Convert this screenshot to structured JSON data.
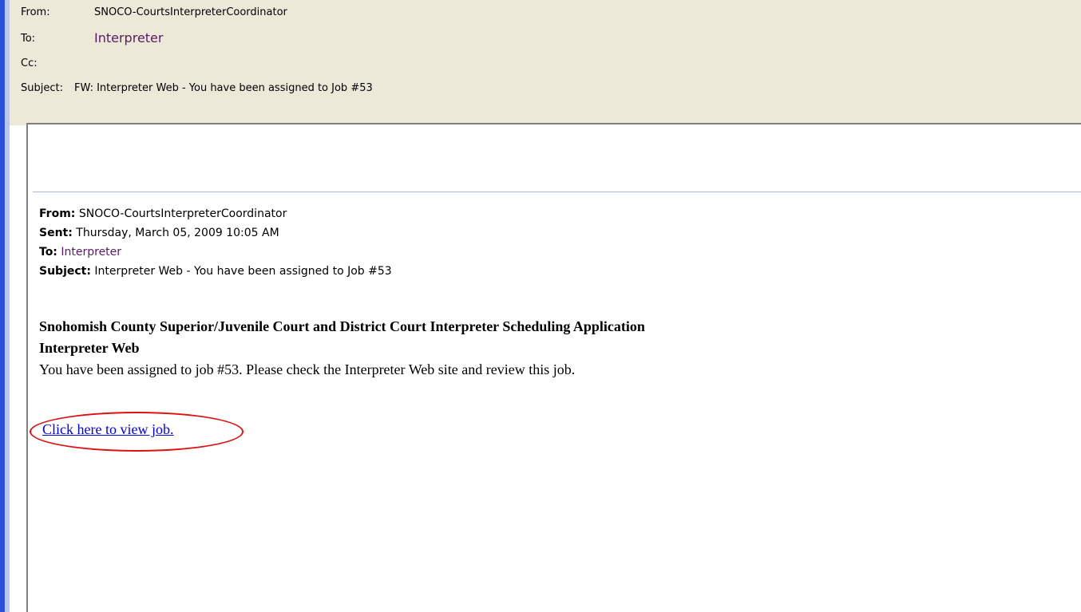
{
  "header": {
    "from_label": "From:",
    "from_value": "SNOCO-CourtsInterpreterCoordinator",
    "to_label": "To:",
    "to_value": "Interpreter",
    "cc_label": "Cc:",
    "cc_value": "",
    "subject_label": "Subject:",
    "subject_value": "FW: Interpreter Web - You have been assigned to Job #53"
  },
  "forwarded": {
    "from_label": "From:",
    "from_value": "SNOCO-CourtsInterpreterCoordinator",
    "sent_label": "Sent:",
    "sent_value": "Thursday, March 05, 2009 10:05 AM",
    "to_label": "To:",
    "to_value": "Interpreter",
    "subject_label": "Subject:",
    "subject_value": "Interpreter Web - You have been assigned to Job #53"
  },
  "body": {
    "app_title": "Snohomish County Superior/Juvenile Court and District Court Interpreter Scheduling Application",
    "app_subtitle": "Interpreter Web",
    "message": "You have been assigned to job #53. Please check the Interpreter Web site and review this job.",
    "link_text": "Click here to view job."
  },
  "colors": {
    "header_bg": "#ece9d8",
    "left_bar": "#2850d8",
    "link": "#0000ee",
    "annotation_circle": "#e01010",
    "recipient": "#5a1a66"
  }
}
